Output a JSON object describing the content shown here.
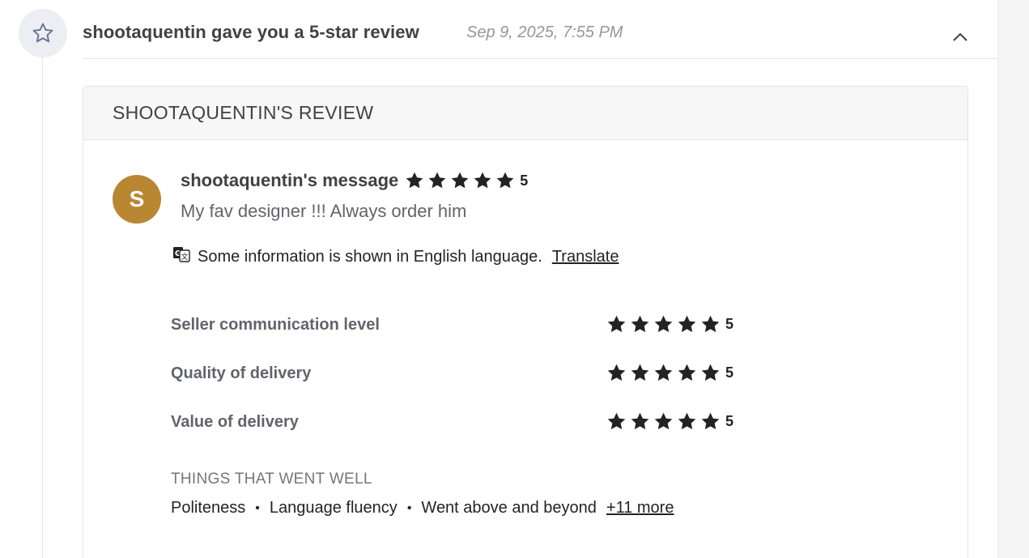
{
  "event": {
    "title": "shootaquentin gave you a 5-star review",
    "date": "Sep 9, 2025, 7:55 PM",
    "icon": "star-outline-icon"
  },
  "review": {
    "header": "SHOOTAQUENTIN'S REVIEW",
    "avatar_letter": "S",
    "avatar_color": "#b98632",
    "message_title": "shootaquentin's message",
    "overall_rating": 5,
    "overall_score_label": "5",
    "message": "My fav designer !!! Always order him",
    "translate_notice": "Some information is shown in English language.",
    "translate_link": "Translate",
    "ratings": [
      {
        "label": "Seller communication level",
        "stars": 5,
        "score_label": "5"
      },
      {
        "label": "Quality of delivery",
        "stars": 5,
        "score_label": "5"
      },
      {
        "label": "Value of delivery",
        "stars": 5,
        "score_label": "5"
      }
    ],
    "went_well_label": "THINGS THAT WENT WELL",
    "tags": [
      "Politeness",
      "Language fluency",
      "Went above and beyond"
    ],
    "more_tags": "+11 more"
  },
  "colors": {
    "star": "#222325",
    "text_primary": "#404145",
    "text_muted": "#95979d"
  }
}
